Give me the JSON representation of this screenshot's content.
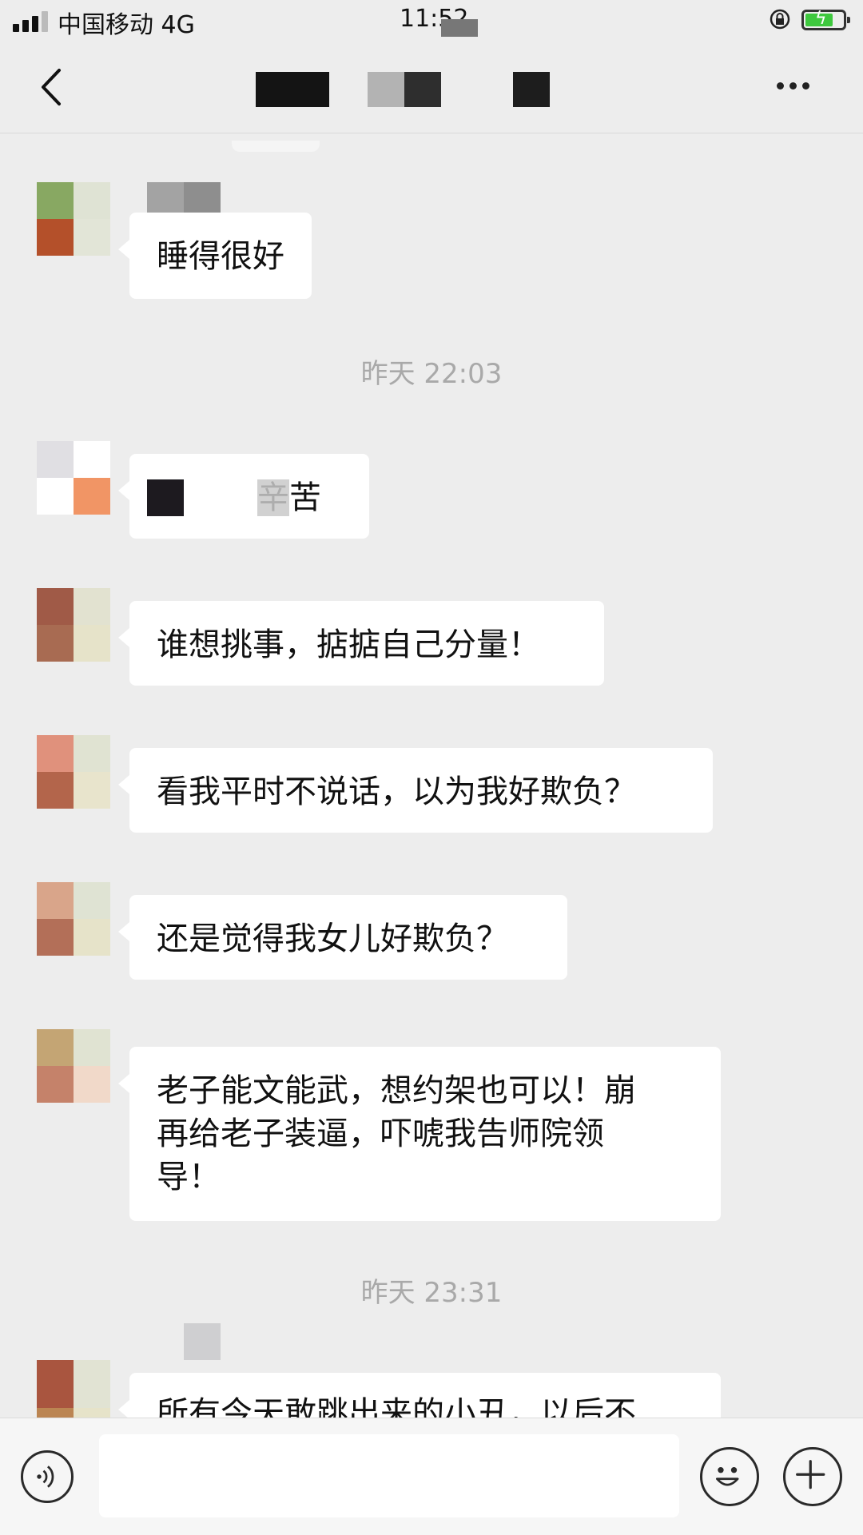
{
  "status_bar": {
    "carrier": "中国移动 4G",
    "time": "11:52",
    "battery_color": "#3ec83e",
    "icons": [
      "signal-icon",
      "orientation-lock-icon",
      "battery-charging-icon"
    ]
  },
  "nav_bar": {
    "back_icon": "chevron-left-icon",
    "more_icon": "more-dots-icon"
  },
  "messages": [
    {
      "type": "text",
      "text": "睡得很好"
    },
    {
      "type": "timestamp",
      "text": "昨天 22:03"
    },
    {
      "type": "text",
      "text": "辛苦"
    },
    {
      "type": "text",
      "text": "谁想挑事，掂掂自己分量！"
    },
    {
      "type": "text",
      "text": "看我平时不说话，以为我好欺负？"
    },
    {
      "type": "text",
      "text": "还是觉得我女儿好欺负？"
    },
    {
      "type": "text",
      "text": "老子能文能武，想约架也可以！崩\n再给老子装逼，吓唬我告师院领\n导！"
    },
    {
      "type": "timestamp",
      "text": "昨天 23:31"
    },
    {
      "type": "text",
      "text": "所有今天敢跳出来的小丑，以后不"
    }
  ],
  "input_bar": {
    "voice_icon": "voice-icon",
    "emoji_icon": "emoji-icon",
    "plus_icon": "plus-icon"
  }
}
